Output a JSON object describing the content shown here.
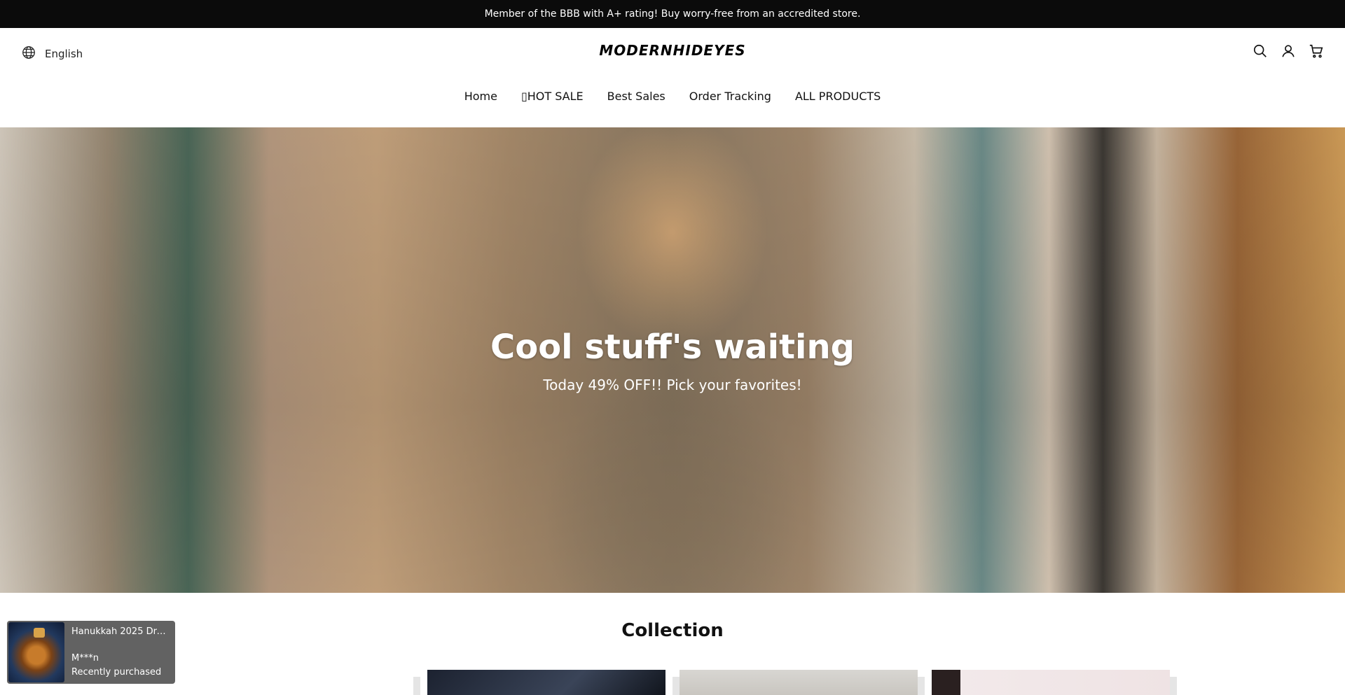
{
  "announcement": "Member of the BBB with A+ rating! Buy worry-free from an accredited store.",
  "header": {
    "language": "English",
    "logo": "MODERNHIDEYES",
    "icons": [
      "search-icon",
      "account-icon",
      "cart-icon"
    ]
  },
  "nav": {
    "items": [
      "Home",
      "▯HOT SALE",
      "Best Sales",
      "Order Tracking",
      "ALL PRODUCTS"
    ]
  },
  "hero": {
    "title": "Cool stuff's waiting",
    "subtitle": "Today 49% OFF!! Pick your favorites!"
  },
  "collection": {
    "heading": "Collection"
  },
  "toast": {
    "product": "Hanukkah 2025 Drei...",
    "user": "M***n",
    "status": "Recently purchased"
  }
}
